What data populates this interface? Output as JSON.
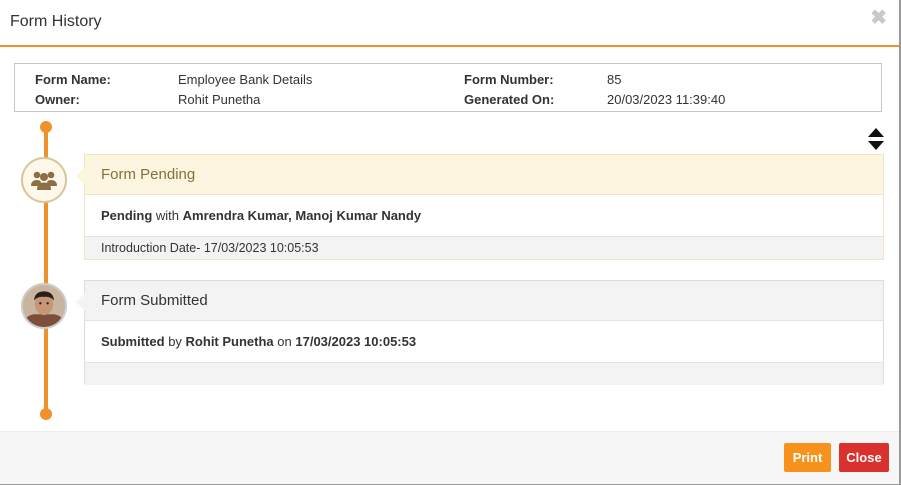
{
  "dialog": {
    "title": "Form History",
    "close_glyph": "✖"
  },
  "form_info": {
    "name_label": "Form Name:",
    "name_value": "Employee Bank Details",
    "owner_label": "Owner:",
    "owner_value": "Rohit Punetha",
    "number_label": "Form Number:",
    "number_value": "85",
    "generated_label": "Generated On:",
    "generated_value": "20/03/2023 11:39:40"
  },
  "timeline": [
    {
      "title": "Form Pending",
      "status": "Pending",
      "connector": "with",
      "people": "Amrendra Kumar, Manoj Kumar Nandy",
      "footer": "Introduction Date- 17/03/2023 10:05:53",
      "icon": "group-icon"
    },
    {
      "title": "Form Submitted",
      "status": "Submitted",
      "connector": "by",
      "people": "Rohit Punetha",
      "on_word": "on",
      "date": "17/03/2023 10:05:53",
      "footer": "",
      "icon": "user-photo"
    }
  ],
  "footer": {
    "print_label": "Print",
    "close_label": "Close"
  },
  "colors": {
    "accent": "#f0922c",
    "pending_head": "#fcf6e0",
    "pending_text": "#8a6d3b",
    "submitted_head": "#f3f3f3",
    "print": "#f7931d",
    "close": "#d9322e"
  }
}
